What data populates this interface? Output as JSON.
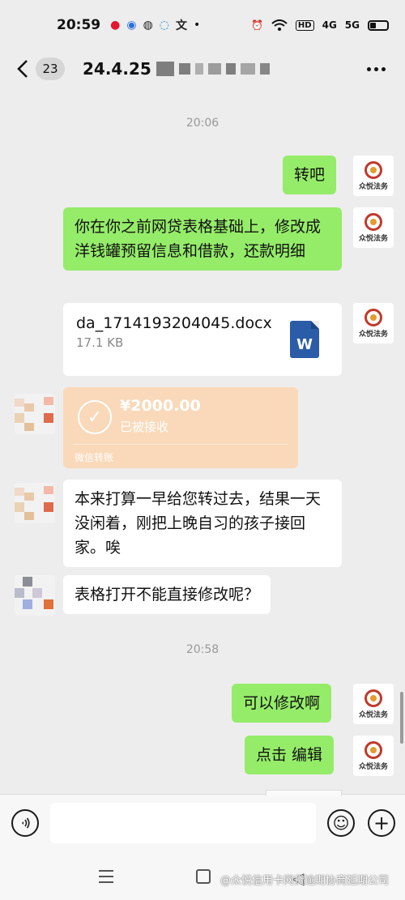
{
  "status_bar": {
    "time": "20:59",
    "app_icons": [
      "weibo-icon",
      "search-app-icon",
      "wechat-icon",
      "browser-icon",
      "dictionary-icon"
    ],
    "dot": "•",
    "hd": "HD",
    "net1": "4G",
    "net2": "5G",
    "battery_level": 0.35
  },
  "header": {
    "back_label": "<",
    "unread_count": "23",
    "title": "24.4.25"
  },
  "messages": {
    "t1": "20:06",
    "m1": "转吧",
    "m2": "你在你之前网贷表格基础上，修改成洋钱罐预留信息和借款，还款明细",
    "file_name": "da_1714193204045.docx",
    "file_size": "17.1 KB",
    "file_icon_letter": "W",
    "transfer_amount": "¥2000.00",
    "transfer_status": "已被接收",
    "transfer_label": "微信转账",
    "m3": "本来打算一早给您转过去，结果一天没闲着，刚把上晚自习的孩子接回家。唉",
    "m4": "表格打开不能直接修改呢？",
    "t2": "20:58",
    "m5": "可以修改啊",
    "m6": "点击 编辑"
  },
  "self_avatar": {
    "logo_text": "众悦法务"
  },
  "input_bar": {
    "placeholder": "",
    "emoji_icon": "☺",
    "plus_icon": "+"
  },
  "watermark": "@众悦信用卡网贷逾期协商延期公司",
  "colors": {
    "sent_bubble": "#95ec69",
    "received_bubble": "#ffffff",
    "transfer_card": "#f9d9b9",
    "background": "#ededed"
  }
}
